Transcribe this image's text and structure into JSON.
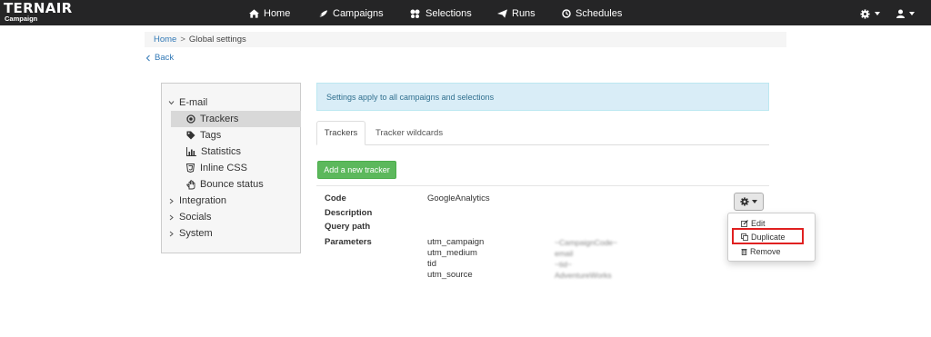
{
  "brand": {
    "name": "TERNAIR",
    "sub": "Campaign"
  },
  "nav": [
    {
      "label": "Home",
      "icon": "home-icon"
    },
    {
      "label": "Campaigns",
      "icon": "campaigns-icon"
    },
    {
      "label": "Selections",
      "icon": "selections-icon"
    },
    {
      "label": "Runs",
      "icon": "paper-plane-icon"
    },
    {
      "label": "Schedules",
      "icon": "clock-icon"
    }
  ],
  "nav_right": {
    "settings_icon": "gear-icon",
    "user_icon": "user-icon"
  },
  "breadcrumb": {
    "home": "Home",
    "separator": ">",
    "current": "Global settings"
  },
  "back_link": {
    "label": "Back",
    "icon": "chevron-left-icon"
  },
  "sidebar": {
    "email_group": "E-mail",
    "email_items": [
      {
        "label": "Trackers",
        "icon": "dot-circle-icon",
        "active": true
      },
      {
        "label": "Tags",
        "icon": "tag-icon"
      },
      {
        "label": "Statistics",
        "icon": "bar-chart-icon"
      },
      {
        "label": "Inline CSS",
        "icon": "css3-icon"
      },
      {
        "label": "Bounce status",
        "icon": "hand-icon"
      }
    ],
    "groups": [
      "Integration",
      "Socials",
      "System"
    ]
  },
  "info_text": "Settings apply to all campaigns and selections",
  "tabs": [
    "Trackers",
    "Tracker wildcards"
  ],
  "add_button": "Add a new tracker",
  "tracker": {
    "labels": {
      "code": "Code",
      "description": "Description",
      "query_path": "Query path",
      "parameters": "Parameters"
    },
    "code": "GoogleAnalytics",
    "parameters": [
      {
        "key": "utm_campaign",
        "value": "~CampaignCode~"
      },
      {
        "key": "utm_medium",
        "value": "email"
      },
      {
        "key": "tid",
        "value": "~tid~"
      },
      {
        "key": "utm_source",
        "value": "AdventureWorks"
      }
    ]
  },
  "menu": {
    "edit": "Edit",
    "duplicate": "Duplicate",
    "remove": "Remove"
  },
  "colors": {
    "navbar": "#252526",
    "info_bg": "#d9edf7",
    "info_text": "#31708f",
    "add_button": "#5cb85c",
    "highlight": "#e02020",
    "link": "#337ab7"
  }
}
